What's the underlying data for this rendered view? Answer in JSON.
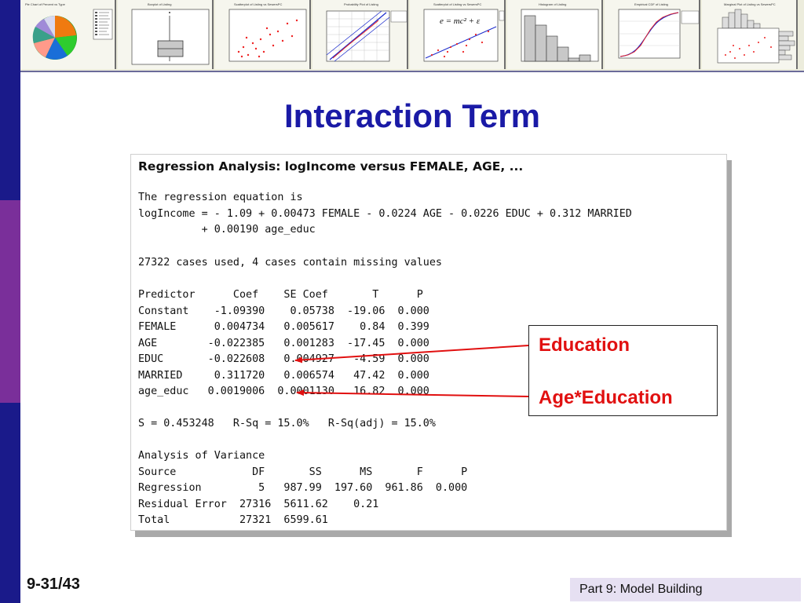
{
  "slide": {
    "title": "Interaction Term",
    "page_number": "9-31/43",
    "part_label": "Part 9: Model Building"
  },
  "thumbnails": [
    {
      "name": "pie-chart-thumbnail",
      "title": "Pie Chart of Percent vs Type"
    },
    {
      "name": "boxplot-thumbnail",
      "title": "Boxplot of Listing"
    },
    {
      "name": "scatterplot-thumbnail",
      "title": "Scatterplot of Listing vs SewersPC"
    },
    {
      "name": "probability-plot-thumbnail",
      "title": "Probability Plot of Listing"
    },
    {
      "name": "regression-scatter-thumbnail",
      "title": "Scatterplot of Listing vs SewersPC",
      "formula": "e = mc² + ε"
    },
    {
      "name": "histogram-thumbnail",
      "title": "Histogram of Listing"
    },
    {
      "name": "empirical-cdf-thumbnail",
      "title": "Empirical CDF of Listing"
    },
    {
      "name": "marginal-plot-thumbnail",
      "title": "Marginal Plot of Listing vs SewersPC"
    }
  ],
  "output": {
    "title": "Regression Analysis: logIncome versus FEMALE, AGE, ...",
    "equation_header": "The regression equation is",
    "equation_line1": "logIncome = - 1.09 + 0.00473 FEMALE - 0.0224 AGE - 0.0226 EDUC + 0.312 MARRIED",
    "equation_line2": "          + 0.00190 age_educ",
    "cases_line": "27322 cases used, 4 cases contain missing values",
    "coef_header": "Predictor      Coef    SE Coef       T      P",
    "coef_rows": [
      "Constant    -1.09390    0.05738  -19.06  0.000",
      "FEMALE      0.004734   0.005617    0.84  0.399",
      "AGE        -0.022385   0.001283  -17.45  0.000",
      "EDUC       -0.022608   0.004927   -4.59  0.000",
      "MARRIED     0.311720   0.006574   47.42  0.000",
      "age_educ   0.0019006  0.0001130   16.82  0.000"
    ],
    "fit_line": "S = 0.453248   R-Sq = 15.0%   R-Sq(adj) = 15.0%",
    "anova_title": "Analysis of Variance",
    "anova_header": "Source            DF       SS      MS       F      P",
    "anova_rows": [
      "Regression         5   987.99  197.60  961.86  0.000",
      "Residual Error  27316  5611.62    0.21",
      "Total           27321  6599.61"
    ]
  },
  "callout": {
    "label1": "Education",
    "label2": "Age*Education"
  },
  "colors": {
    "title_blue": "#1a1aa6",
    "annotation_red": "#e11010",
    "left_bar_navy": "#1a1a8a",
    "left_bar_purple": "#7a2f9a"
  }
}
